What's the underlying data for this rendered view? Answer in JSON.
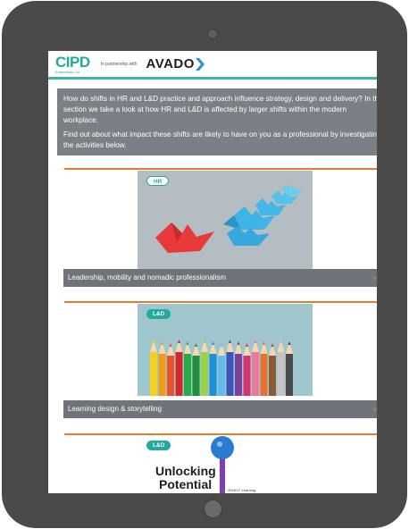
{
  "header": {
    "cipd_logo": "CIPD",
    "cipd_sub": "Enterprises Ltd",
    "partnership": "In partnership with",
    "avado_logo": "AVADO"
  },
  "intro": {
    "paragraph1_line1": "How do shifts in HR and L&D practice and approach influence strategy, design and delivery? In this",
    "paragraph1_line2": "section we take a look at how HR and L&D is affected by larger shifts within the modern",
    "paragraph1_line3": "workplace.",
    "paragraph2_line1": "Find out about what impact these shifts are likely to have on you as a professional by investigating",
    "paragraph2_line2": "the activities below."
  },
  "cards": [
    {
      "badge": "HR",
      "label": "Leadership, mobility and nomadic professionalism",
      "arrow": "»"
    },
    {
      "badge": "L&D",
      "label": "Learning design & storytelling",
      "arrow": "»"
    },
    {
      "badge": "L&D",
      "poster_title_1": "Unlocking",
      "poster_title_2": "Potential",
      "poster_sub": "2016/17 Learning"
    }
  ],
  "colors": {
    "teal": "#23aaa0",
    "orange": "#e87b2e",
    "intro_bg": "#7b7f86",
    "tablet_frame": "#4a4a4a"
  },
  "icons": [
    "avado-chevron-icon",
    "camera-icon",
    "home-button-icon",
    "arrow-right-icon",
    "key-icon"
  ]
}
